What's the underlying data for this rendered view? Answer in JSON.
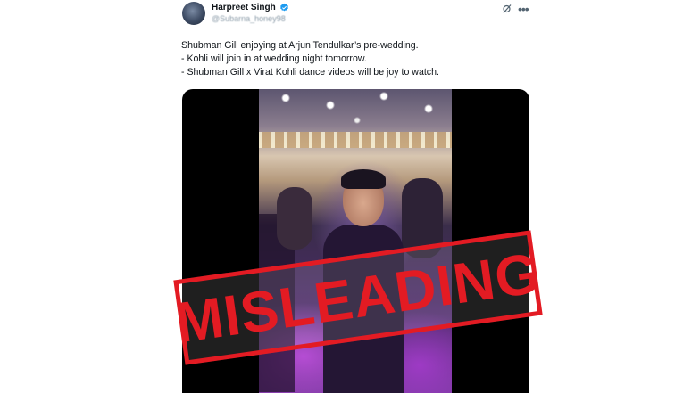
{
  "author": {
    "name": "Harpreet Singh",
    "handle": "@Subarna_honey98",
    "verified_color": "#1d9bf0"
  },
  "tweet": {
    "lines": [
      "Shubman Gill enjoying at Arjun Tendulkar’s pre-wedding.",
      "- Kohli will join in at wedding night tomorrow.",
      "- Shubman Gill x Virat Kohli dance videos will be joy to watch."
    ]
  },
  "icons": {
    "verified": "verified-badge-icon",
    "grok": "grok-icon",
    "more": "more-options-icon"
  },
  "stamp": {
    "label": "MISLEADING",
    "color": "#e31b23"
  }
}
